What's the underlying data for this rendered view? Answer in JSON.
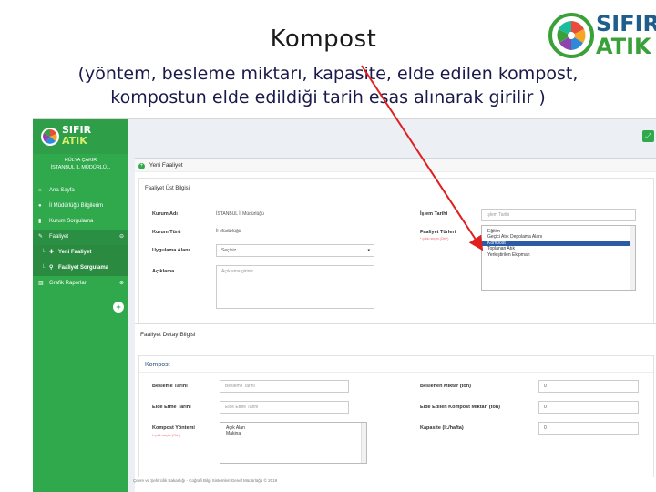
{
  "slide": {
    "title": "Kompost",
    "subtitle_line1": "(yöntem, besleme miktarı, kapasite, elde edilen kompost,",
    "subtitle_line2": "kompostun elde edildiği tarih esas alınarak girilir )",
    "logo_word1": "SIFIR",
    "logo_word2": "ATIK"
  },
  "sidebar": {
    "logo_word1": "SIFIR",
    "logo_word2": "ATIK",
    "user_name": "HÜLYA ÇAKIR",
    "user_unit": "İSTANBUL İL MÜDÜRLÜ...",
    "items": [
      {
        "label": "Ana Sayfa",
        "icon": "home-icon"
      },
      {
        "label": "İl Müdürlüğü Bilgilerim",
        "icon": "info-icon"
      },
      {
        "label": "Kurum Sorgulama",
        "icon": "building-icon"
      },
      {
        "label": "Faaliyet",
        "icon": "edit-icon"
      },
      {
        "label": "Yeni Faaliyet",
        "icon": "plus-circle-icon"
      },
      {
        "label": "Faaliyet Sorgulama",
        "icon": "search-icon"
      },
      {
        "label": "Grafik Raporlar",
        "icon": "bar-chart-icon"
      }
    ]
  },
  "panel": {
    "header": "Yeni Faaliyet",
    "ust_bilgi_title": "Faaliyet Üst Bilgisi",
    "kurum_adi_label": "Kurum Adı",
    "kurum_adi_value": "İSTANBUL İl Müdürlüğü",
    "kurum_turu_label": "Kurum Türü",
    "kurum_turu_value": "İl Müdürlüğü",
    "uygulama_alani_label": "Uygulama Alanı",
    "uygulama_alani_value": "Seçiniz",
    "aciklama_label": "Açıklama",
    "aciklama_placeholder": "Açıklama giriniz.",
    "islem_tarihi_label": "İşlem Tarihi",
    "islem_tarihi_placeholder": "İşlem Tarihi",
    "faaliyet_turleri_label": "Faaliyet Türleri",
    "faaliyet_turleri_hint": "* çoklu seçim (Ctrl+)",
    "faaliyet_turleri_options": [
      "Eğitim",
      "Geçici Atık Depolama Alanı",
      "Kompost",
      "Toplanan Atık",
      "Yerleştirilen Ekipman"
    ],
    "faaliyet_turleri_selected": "Kompost"
  },
  "detail": {
    "title": "Faaliyet Detay Bilgisi",
    "kompost_title": "Kompost",
    "besleme_tarihi_label": "Besleme Tarihi",
    "besleme_tarihi_placeholder": "Besleme Tarihi",
    "elde_etme_tarihi_label": "Elde Etme Tarihi",
    "elde_etme_tarihi_placeholder": "Elde Etme Tarihi",
    "kompost_yontemi_label": "Kompost Yöntemi",
    "kompost_yontemi_hint": "* çoklu seçim (Ctrl+)",
    "kompost_yontemi_options": [
      "Açık Alan",
      "Makina"
    ],
    "beslenen_miktar_label": "Beslenen Miktar (ton)",
    "beslenen_miktar_value": "0",
    "elde_edilen_label": "Elde Edilen Kompost Miktarı (ton)",
    "elde_edilen_value": "0",
    "kapasite_label": "Kapasite (lt./hafta)",
    "kapasite_value": "0"
  },
  "footer": "Çevre ve Şehircilik Bakanlığı - Coğrafi Bilgi Sistemleri Genel Müdürlüğü © 2019",
  "colors": {
    "sidebar_green": "#30a84c",
    "selected_blue": "#2b5aa6",
    "arrow_red": "#e02020"
  }
}
